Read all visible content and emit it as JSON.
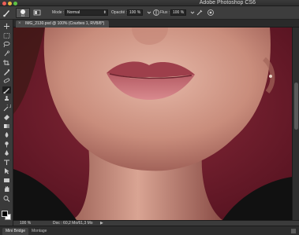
{
  "app": {
    "title": "Adobe Photoshop CS6"
  },
  "options_bar": {
    "brush_size": "63",
    "mode_label": "Mode :",
    "mode_value": "Normal",
    "opacity_label": "Opacité :",
    "opacity_value": "100 %",
    "flow_label": "Flux :",
    "flow_value": "100 %"
  },
  "document": {
    "tab_title": "IMG_2130.psd @ 100% (Courbes 1, RVB/8*)",
    "close_glyph": "×"
  },
  "status": {
    "zoom": "100 %",
    "doc_info": "Doc : 60,2 Mo/61,3 Mo",
    "arrow": "▶"
  },
  "bottom_panel": {
    "tabs": [
      "Mini Bridge",
      "Montage"
    ]
  },
  "icons": {
    "toolbar": [
      "move-icon",
      "marquee-icon",
      "lasso-icon",
      "quick-select-icon",
      "crop-icon",
      "eyedropper-icon",
      "healing-icon",
      "brush-icon",
      "clone-stamp-icon",
      "history-brush-icon",
      "eraser-icon",
      "gradient-icon",
      "blur-icon",
      "dodge-icon",
      "pen-icon",
      "type-icon",
      "path-select-icon",
      "shape-icon",
      "hand-icon",
      "zoom-icon"
    ]
  },
  "colors": {
    "ui_dark": "#2b2b2b",
    "background_maroon": "#6a1a2a",
    "foreground_swatch": "#000000",
    "background_swatch": "#ffffff"
  }
}
